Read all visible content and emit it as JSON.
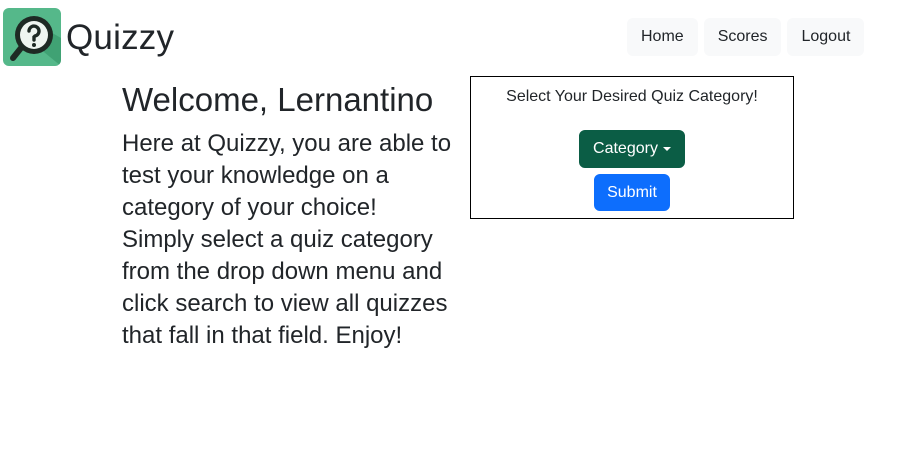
{
  "brand": {
    "name": "Quizzy",
    "logo_icon": "magnifier-question-icon",
    "logo_color": "#55b88a"
  },
  "nav": {
    "home": "Home",
    "scores": "Scores",
    "logout": "Logout"
  },
  "intro": {
    "heading": "Welcome, Lernantino",
    "body": "Here at Quizzy, you are able to test your knowledge on a category of your choice! Simply select a quiz category from the drop down menu and click search to view all quizzes that fall in that field. Enjoy!"
  },
  "category_panel": {
    "prompt": "Select Your Desired Quiz Category!",
    "dropdown_label": "Category",
    "submit_label": "Submit"
  },
  "colors": {
    "dropdown_bg": "#0b5d45",
    "submit_bg": "#0d6efd",
    "nav_bg": "#f8f9fa"
  }
}
